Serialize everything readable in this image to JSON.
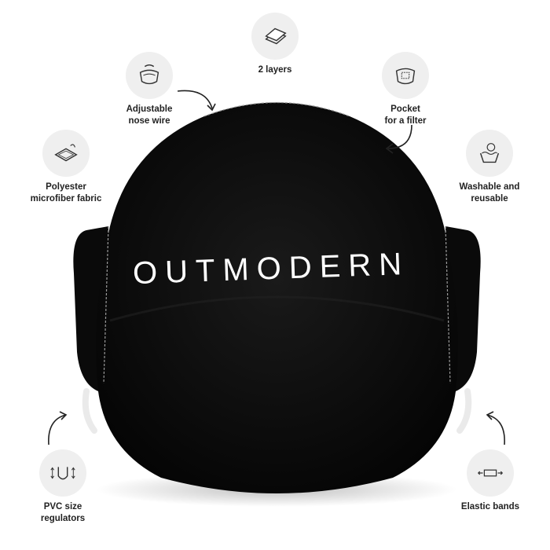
{
  "brand_text": "OUTMODERN",
  "features": [
    {
      "id": "layers",
      "label": "2 layers",
      "icon": "layers-icon"
    },
    {
      "id": "nose",
      "label": "Adjustable\nnose wire",
      "icon": "nose-wire-icon"
    },
    {
      "id": "pocket",
      "label": "Pocket\nfor a filter",
      "icon": "filter-pocket-icon"
    },
    {
      "id": "fabric",
      "label": "Polyester\nmicrofiber fabric",
      "icon": "fabric-icon"
    },
    {
      "id": "wash",
      "label": "Washable and\nreusable",
      "icon": "wash-icon"
    },
    {
      "id": "pvc",
      "label": "PVC size\nregulators",
      "icon": "regulator-icon"
    },
    {
      "id": "elastic",
      "label": "Elastic bands",
      "icon": "elastic-icon"
    }
  ],
  "colors": {
    "mask": "#0b0b0b",
    "icon_bg": "#efefef",
    "text": "#222222",
    "stitch": "#9a9a9a"
  }
}
